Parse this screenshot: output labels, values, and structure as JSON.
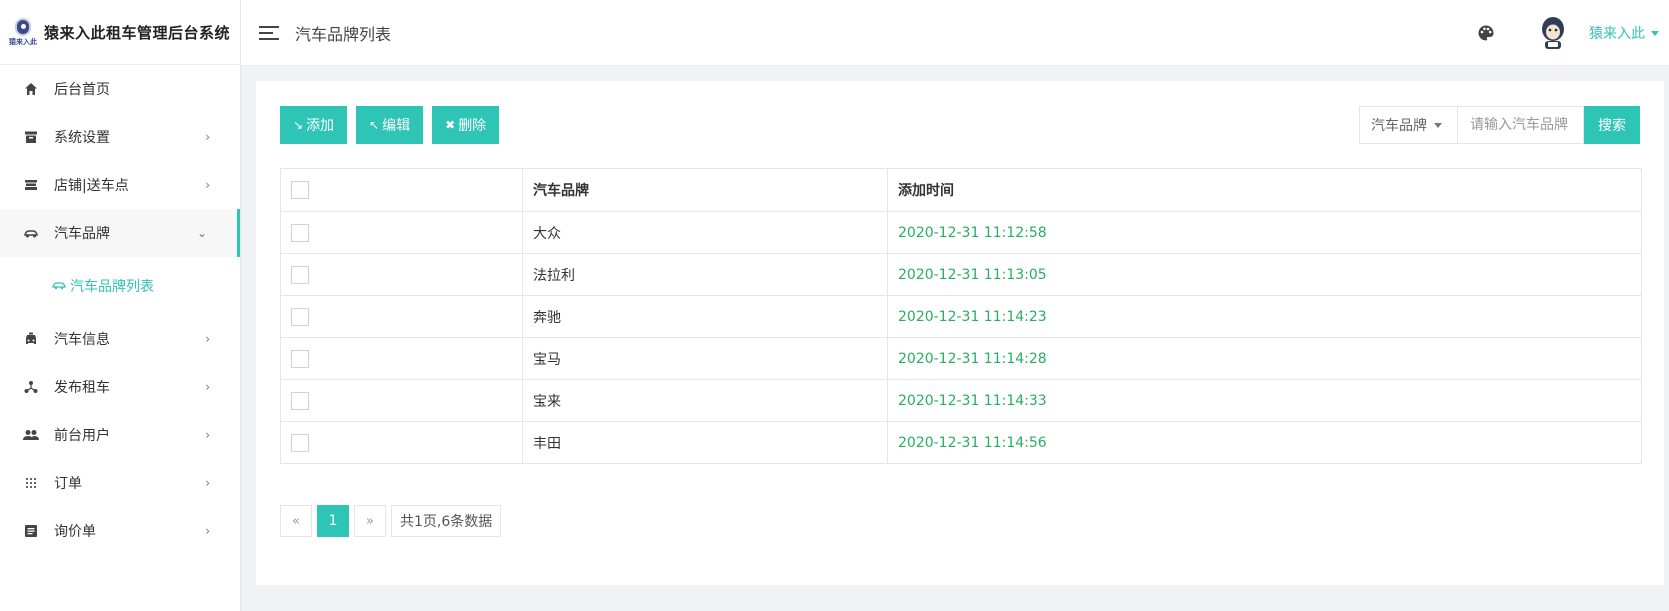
{
  "brand": {
    "logo_text": "猿来入此",
    "title": "猿来入此租车管理后台系统"
  },
  "header": {
    "page_title": "汽车品牌列表",
    "user_name": "猿来入此"
  },
  "sidebar": {
    "items": [
      {
        "label": "后台首页",
        "icon": "home-icon"
      },
      {
        "label": "系统设置",
        "icon": "archive-icon"
      },
      {
        "label": "店铺|送车点",
        "icon": "store-icon"
      },
      {
        "label": "汽车品牌",
        "icon": "car-icon"
      },
      {
        "label": "汽车信息",
        "icon": "taxi-icon"
      },
      {
        "label": "发布租车",
        "icon": "network-icon"
      },
      {
        "label": "前台用户",
        "icon": "users-icon"
      },
      {
        "label": "订单",
        "icon": "grid-icon"
      },
      {
        "label": "询价单",
        "icon": "list-icon"
      }
    ],
    "submenu": {
      "label": "汽车品牌列表",
      "icon": "car-small-icon"
    }
  },
  "toolbar": {
    "add_label": "添加",
    "edit_label": "编辑",
    "delete_label": "删除"
  },
  "search": {
    "select_label": "汽车品牌",
    "placeholder": "请输入汽车品牌",
    "button_label": "搜索"
  },
  "table": {
    "headers": [
      "",
      "汽车品牌",
      "添加时间"
    ],
    "rows": [
      {
        "brand": "大众",
        "time": "2020-12-31 11:12:58"
      },
      {
        "brand": "法拉利",
        "time": "2020-12-31 11:13:05"
      },
      {
        "brand": "奔驰",
        "time": "2020-12-31 11:14:23"
      },
      {
        "brand": "宝马",
        "time": "2020-12-31 11:14:28"
      },
      {
        "brand": "宝来",
        "time": "2020-12-31 11:14:33"
      },
      {
        "brand": "丰田",
        "time": "2020-12-31 11:14:56"
      }
    ]
  },
  "pager": {
    "prev": "«",
    "current": "1",
    "next": "»",
    "info": "共1页,6条数据"
  },
  "colors": {
    "accent": "#2ec4b6",
    "time_text": "#27ae60"
  }
}
